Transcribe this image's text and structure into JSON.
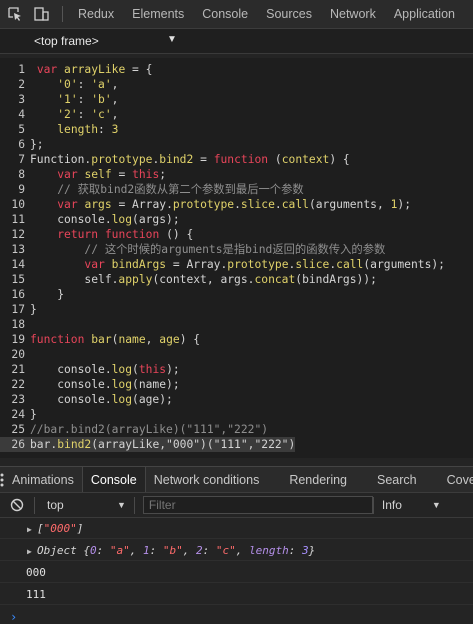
{
  "tabs": [
    "Redux",
    "Elements",
    "Console",
    "Sources",
    "Network",
    "Application"
  ],
  "frame": {
    "label": "<top frame>",
    "arrow": "▼"
  },
  "code_lines": [
    [
      [
        "ln",
        "1"
      ],
      [
        "src",
        " "
      ],
      [
        "kw",
        "var"
      ],
      [
        "src",
        " "
      ],
      [
        "vr",
        "arrayLike"
      ],
      [
        "src",
        " = {"
      ]
    ],
    [
      [
        "ln",
        "2"
      ],
      [
        "src",
        "    "
      ],
      [
        "str",
        "'0'"
      ],
      [
        "src",
        ": "
      ],
      [
        "str",
        "'a'"
      ],
      [
        "src",
        ","
      ]
    ],
    [
      [
        "ln",
        "3"
      ],
      [
        "src",
        "    "
      ],
      [
        "str",
        "'1'"
      ],
      [
        "src",
        ": "
      ],
      [
        "str",
        "'b'"
      ],
      [
        "src",
        ","
      ]
    ],
    [
      [
        "ln",
        "4"
      ],
      [
        "src",
        "    "
      ],
      [
        "str",
        "'2'"
      ],
      [
        "src",
        ": "
      ],
      [
        "str",
        "'c'"
      ],
      [
        "src",
        ","
      ]
    ],
    [
      [
        "ln",
        "5"
      ],
      [
        "src",
        "    "
      ],
      [
        "prop",
        "length"
      ],
      [
        "src",
        ": "
      ],
      [
        "num",
        "3"
      ]
    ],
    [
      [
        "ln",
        "6"
      ],
      [
        "src",
        "};"
      ]
    ],
    [
      [
        "ln",
        "7"
      ],
      [
        "fn",
        "Function"
      ],
      [
        "src",
        "."
      ],
      [
        "prop",
        "prototype"
      ],
      [
        "src",
        "."
      ],
      [
        "prop",
        "bind2"
      ],
      [
        "src",
        " = "
      ],
      [
        "kw",
        "function"
      ],
      [
        "src",
        " ("
      ],
      [
        "vr",
        "context"
      ],
      [
        "src",
        ") {"
      ]
    ],
    [
      [
        "ln",
        "8"
      ],
      [
        "src",
        "    "
      ],
      [
        "kw",
        "var"
      ],
      [
        "src",
        " "
      ],
      [
        "vr",
        "self"
      ],
      [
        "src",
        " = "
      ],
      [
        "kw",
        "this"
      ],
      [
        "src",
        ";"
      ]
    ],
    [
      [
        "ln",
        "9"
      ],
      [
        "src",
        "    "
      ],
      [
        "cm",
        "// 获取bind2函数从第二个参数到最后一个参数"
      ]
    ],
    [
      [
        "ln",
        "10"
      ],
      [
        "src",
        "    "
      ],
      [
        "kw",
        "var"
      ],
      [
        "src",
        " "
      ],
      [
        "vr",
        "args"
      ],
      [
        "src",
        " = Array."
      ],
      [
        "prop",
        "prototype"
      ],
      [
        "src",
        "."
      ],
      [
        "prop",
        "slice"
      ],
      [
        "src",
        "."
      ],
      [
        "prop",
        "call"
      ],
      [
        "src",
        "(arguments, "
      ],
      [
        "num",
        "1"
      ],
      [
        "src",
        ");"
      ]
    ],
    [
      [
        "ln",
        "11"
      ],
      [
        "src",
        "    console."
      ],
      [
        "prop",
        "log"
      ],
      [
        "src",
        "(args);"
      ]
    ],
    [
      [
        "ln",
        "12"
      ],
      [
        "src",
        "    "
      ],
      [
        "kw",
        "return"
      ],
      [
        "src",
        " "
      ],
      [
        "kw",
        "function"
      ],
      [
        "src",
        " () {"
      ]
    ],
    [
      [
        "ln",
        "13"
      ],
      [
        "src",
        "        "
      ],
      [
        "cm",
        "// 这个时候的arguments是指bind返回的函数传入的参数"
      ]
    ],
    [
      [
        "ln",
        "14"
      ],
      [
        "src",
        "        "
      ],
      [
        "kw",
        "var"
      ],
      [
        "src",
        " "
      ],
      [
        "vr",
        "bindArgs"
      ],
      [
        "src",
        " = Array."
      ],
      [
        "prop",
        "prototype"
      ],
      [
        "src",
        "."
      ],
      [
        "prop",
        "slice"
      ],
      [
        "src",
        "."
      ],
      [
        "prop",
        "call"
      ],
      [
        "src",
        "(arguments);"
      ]
    ],
    [
      [
        "ln",
        "15"
      ],
      [
        "src",
        "        self."
      ],
      [
        "prop",
        "apply"
      ],
      [
        "src",
        "(context, args."
      ],
      [
        "prop",
        "concat"
      ],
      [
        "src",
        "(bindArgs));"
      ]
    ],
    [
      [
        "ln",
        "16"
      ],
      [
        "src",
        "    }"
      ]
    ],
    [
      [
        "ln",
        "17"
      ],
      [
        "src",
        "}"
      ]
    ],
    [
      [
        "ln",
        "18"
      ],
      [
        "src",
        ""
      ]
    ],
    [
      [
        "ln",
        "19"
      ],
      [
        "kw",
        "function"
      ],
      [
        "src",
        " "
      ],
      [
        "vr",
        "bar"
      ],
      [
        "src",
        "("
      ],
      [
        "vr",
        "name"
      ],
      [
        "src",
        ", "
      ],
      [
        "vr",
        "age"
      ],
      [
        "src",
        ") {"
      ]
    ],
    [
      [
        "ln",
        "20"
      ],
      [
        "src",
        ""
      ]
    ],
    [
      [
        "ln",
        "21"
      ],
      [
        "src",
        "    console."
      ],
      [
        "prop",
        "log"
      ],
      [
        "src",
        "("
      ],
      [
        "kw",
        "this"
      ],
      [
        "src",
        ");"
      ]
    ],
    [
      [
        "ln",
        "22"
      ],
      [
        "src",
        "    console."
      ],
      [
        "prop",
        "log"
      ],
      [
        "src",
        "(name);"
      ]
    ],
    [
      [
        "ln",
        "23"
      ],
      [
        "src",
        "    console."
      ],
      [
        "prop",
        "log"
      ],
      [
        "src",
        "(age);"
      ]
    ],
    [
      [
        "ln",
        "24"
      ],
      [
        "src",
        "}"
      ]
    ],
    [
      [
        "ln",
        "25"
      ],
      [
        "cm",
        "//bar.bind2(arrayLike)(\"111\",\"222\")"
      ]
    ],
    [
      [
        "ln",
        "26"
      ],
      [
        "src",
        "bar."
      ],
      [
        "prop",
        "bind2"
      ],
      [
        "src",
        "(arrayLike,\"000\")(\"111\",\"222\")"
      ]
    ]
  ],
  "drawer_tabs": [
    "Animations",
    "Console",
    "Network conditions",
    "Rendering",
    "Search",
    "Cove"
  ],
  "console_toolbar": {
    "context": "top",
    "filter_placeholder": "Filter",
    "level": "Info"
  },
  "console_lines": [
    {
      "type": "array",
      "parts": [
        [
          "it",
          "["
        ],
        [
          "cstr",
          "\"000\""
        ],
        [
          "it",
          "]"
        ]
      ]
    },
    {
      "type": "object",
      "parts": [
        [
          "it",
          "Object {"
        ],
        [
          "ckey",
          "0"
        ],
        [
          "it",
          ": "
        ],
        [
          "cstr",
          "\"a\""
        ],
        [
          "it",
          ", "
        ],
        [
          "ckey",
          "1"
        ],
        [
          "it",
          ": "
        ],
        [
          "cstr",
          "\"b\""
        ],
        [
          "it",
          ", "
        ],
        [
          "ckey",
          "2"
        ],
        [
          "it",
          ": "
        ],
        [
          "cstr",
          "\"c\""
        ],
        [
          "it",
          ", "
        ],
        [
          "ckey",
          "length"
        ],
        [
          "it",
          ": "
        ],
        [
          "cnum",
          "3"
        ],
        [
          "it",
          "}"
        ]
      ]
    },
    {
      "type": "plain",
      "text": "000"
    },
    {
      "type": "plain",
      "text": "111"
    }
  ],
  "prompt": "›",
  "colors": {
    "keyword": "#e8455a",
    "string": "#e0d26a",
    "comment": "#8f8f8f",
    "console_string": "#ff6b6b",
    "prompt": "#3a8cff"
  },
  "icons": [
    "inspect-element-icon",
    "device-toolbar-icon",
    "console-clear-icon",
    "dropdown-arrow-icon",
    "more-menu-icon",
    "expand-triangle-icon",
    "prompt-chevron-icon"
  ]
}
